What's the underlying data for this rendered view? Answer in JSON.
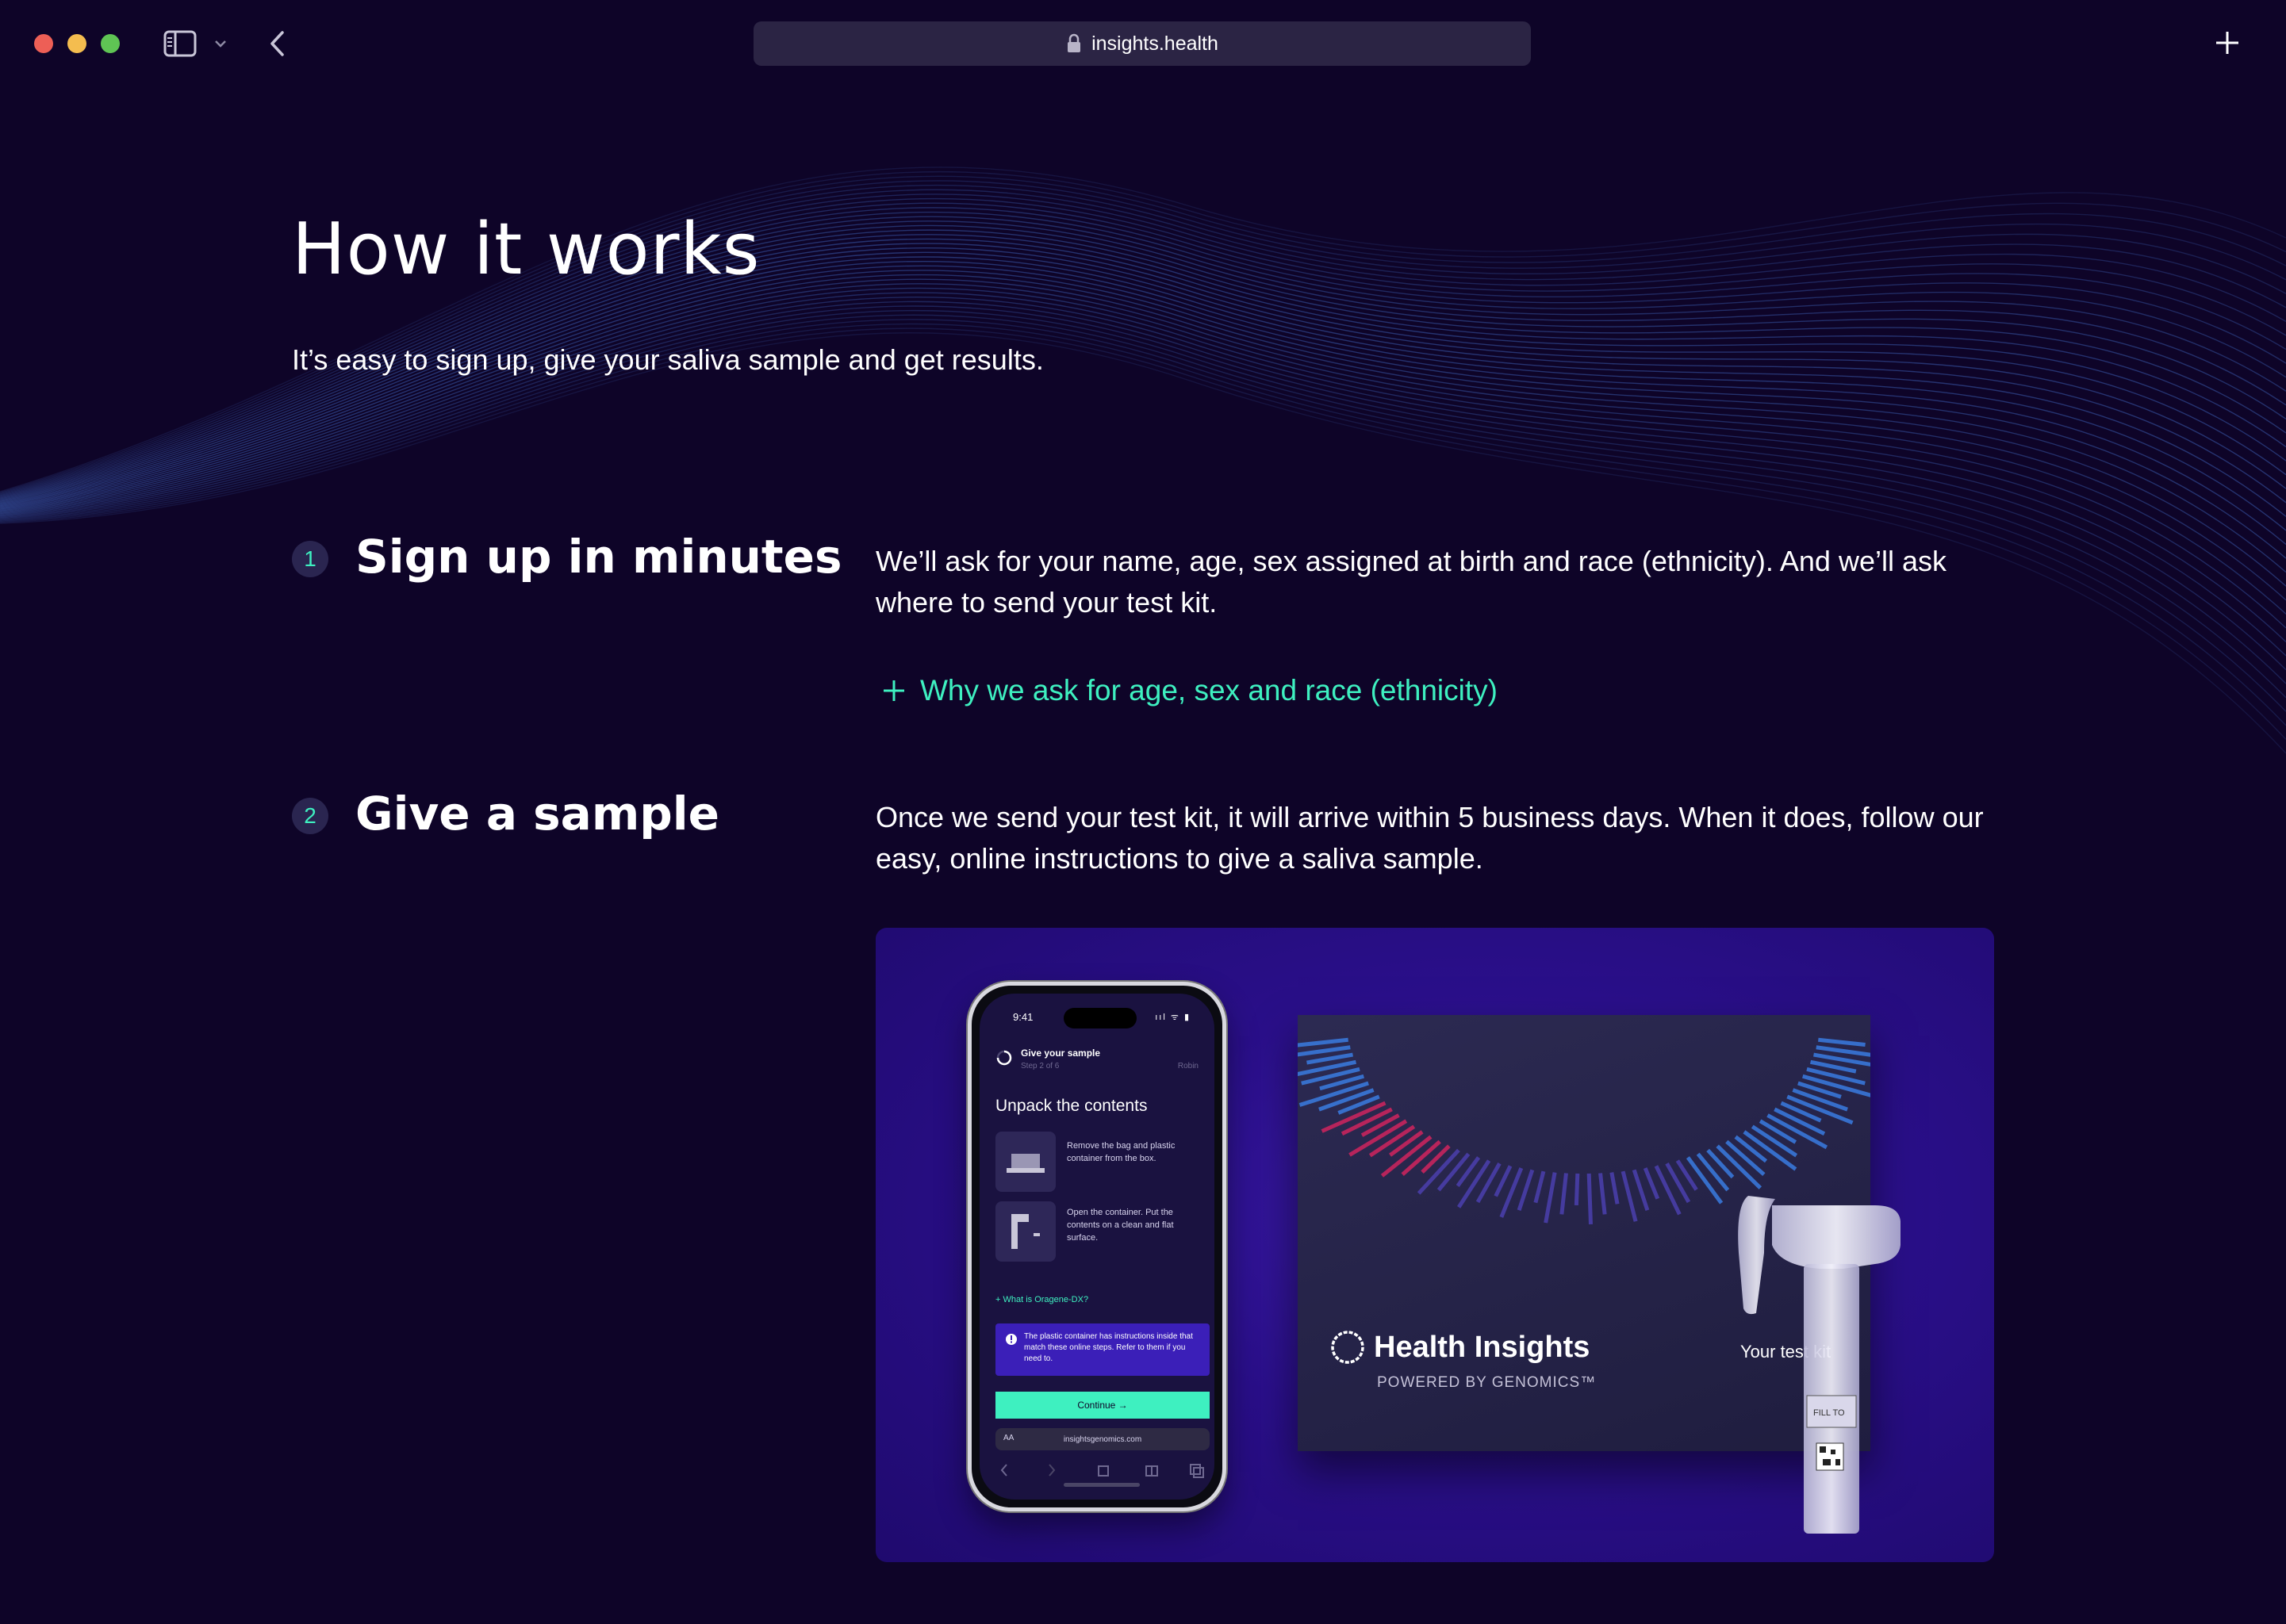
{
  "browser": {
    "url": "insights.health",
    "icons": [
      "close-dot",
      "minimize-dot",
      "zoom-dot",
      "sidebar-icon",
      "chevron-down-icon",
      "back-arrow-icon",
      "lock-icon",
      "plus-icon"
    ]
  },
  "hero": {
    "title": "How it works",
    "subtitle": "It’s easy to sign up, give your saliva sample and get results."
  },
  "steps": [
    {
      "number": "1",
      "heading": "Sign up in minutes",
      "description": "We’ll ask for your name, age, sex assigned at birth and race (ethnicity). And we’ll ask where to send your test kit.",
      "link": "Why we ask for age, sex and race (ethnicity)"
    },
    {
      "number": "2",
      "heading": "Give a sample",
      "description": "Once we send your test kit, it will arrive within 5 business days. When it does, follow our easy, online instructions to give a saliva sample."
    }
  ],
  "phone": {
    "time": "9:41",
    "status": "ııl ᯤ ▮",
    "header": "Give your sample",
    "subheader": "Step 2 of 6",
    "right_label": "Robin",
    "title": "Unpack the contents",
    "item1": "Remove the bag and plastic container from the box.",
    "item2": "Open the container. Put the contents on a clean and flat surface.",
    "link": "+ What is Oragene-DX?",
    "note": "The plastic container has instructions inside that match these online steps. Refer to them if you need to.",
    "button": "Continue →",
    "aa": "AA",
    "url": "insightsgenomics.com"
  },
  "kit_box": {
    "brand": "Health Insights",
    "powered": "POWERED BY GENOMICS™",
    "label": "Your test kit"
  },
  "colors": {
    "background": "#0e0428",
    "accent": "#3ef0c0",
    "card": "#2a0f8a",
    "wave": "#3c5fb4"
  }
}
